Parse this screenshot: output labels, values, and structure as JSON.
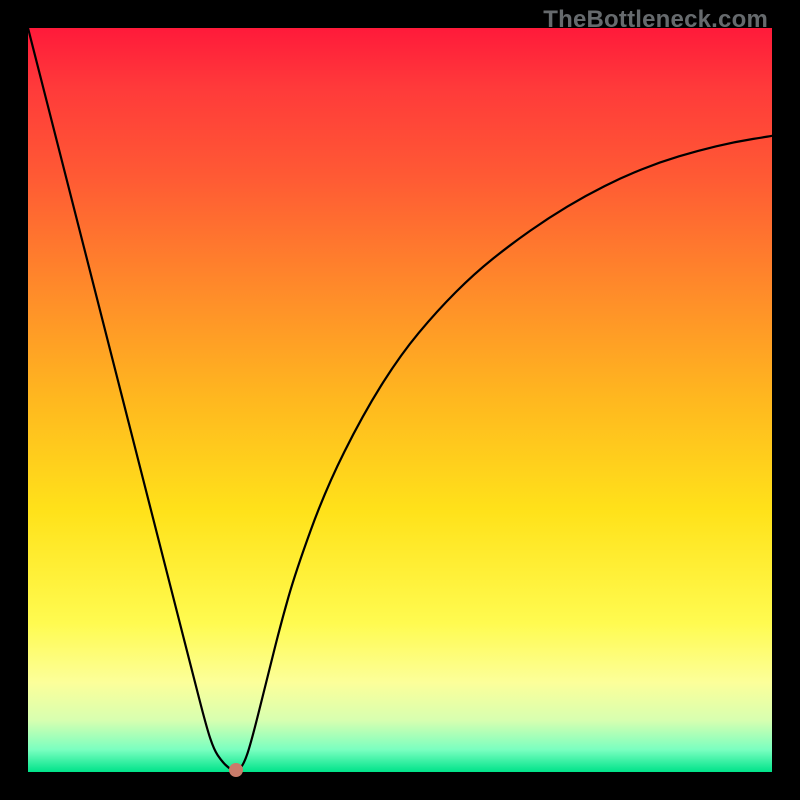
{
  "watermark": "TheBottleneck.com",
  "chart_data": {
    "type": "line",
    "title": "",
    "xlabel": "",
    "ylabel": "",
    "xlim": [
      0,
      100
    ],
    "ylim": [
      0,
      100
    ],
    "x": [
      0,
      5,
      10,
      15,
      20,
      22,
      24,
      25,
      26,
      27,
      28,
      29,
      30,
      32,
      34,
      36,
      40,
      45,
      50,
      55,
      60,
      65,
      70,
      75,
      80,
      85,
      90,
      95,
      100
    ],
    "values": [
      100,
      80.4,
      60.8,
      41.2,
      21.6,
      13.8,
      6.0,
      3.0,
      1.5,
      0.5,
      0.0,
      1.0,
      4.0,
      12.0,
      20.0,
      27.0,
      38.0,
      48.0,
      56.0,
      62.0,
      67.0,
      71.0,
      74.5,
      77.5,
      80.0,
      82.0,
      83.5,
      84.7,
      85.5
    ],
    "marker": {
      "x": 28,
      "y": 0
    },
    "background_gradient": {
      "top_color": "#ff1a3a",
      "bottom_color": "#00e38a"
    }
  }
}
